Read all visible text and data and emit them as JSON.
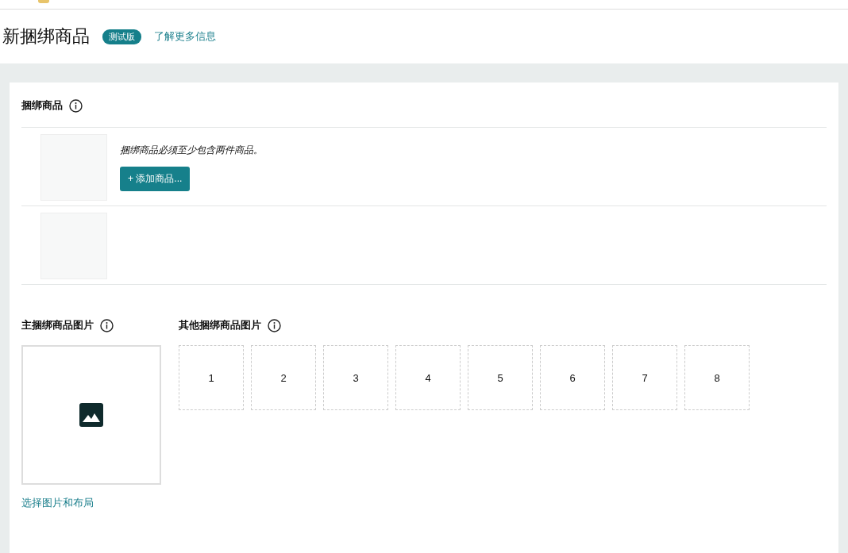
{
  "header": {
    "title": "新捆绑商品",
    "badge": "测试版",
    "link": "了解更多信息"
  },
  "bundle_section": {
    "title": "捆绑商品",
    "items": [
      {
        "kind": "empty",
        "note": "捆绑商品必须至少包含两件商品。",
        "button": "+ 添加商品..."
      },
      {
        "kind": "blank"
      }
    ]
  },
  "images": {
    "main": {
      "title": "主捆绑商品图片",
      "link": "选择图片和布局"
    },
    "other": {
      "title": "其他捆绑商品图片",
      "slots": [
        "1",
        "2",
        "3",
        "4",
        "5",
        "6",
        "7",
        "8"
      ]
    }
  }
}
